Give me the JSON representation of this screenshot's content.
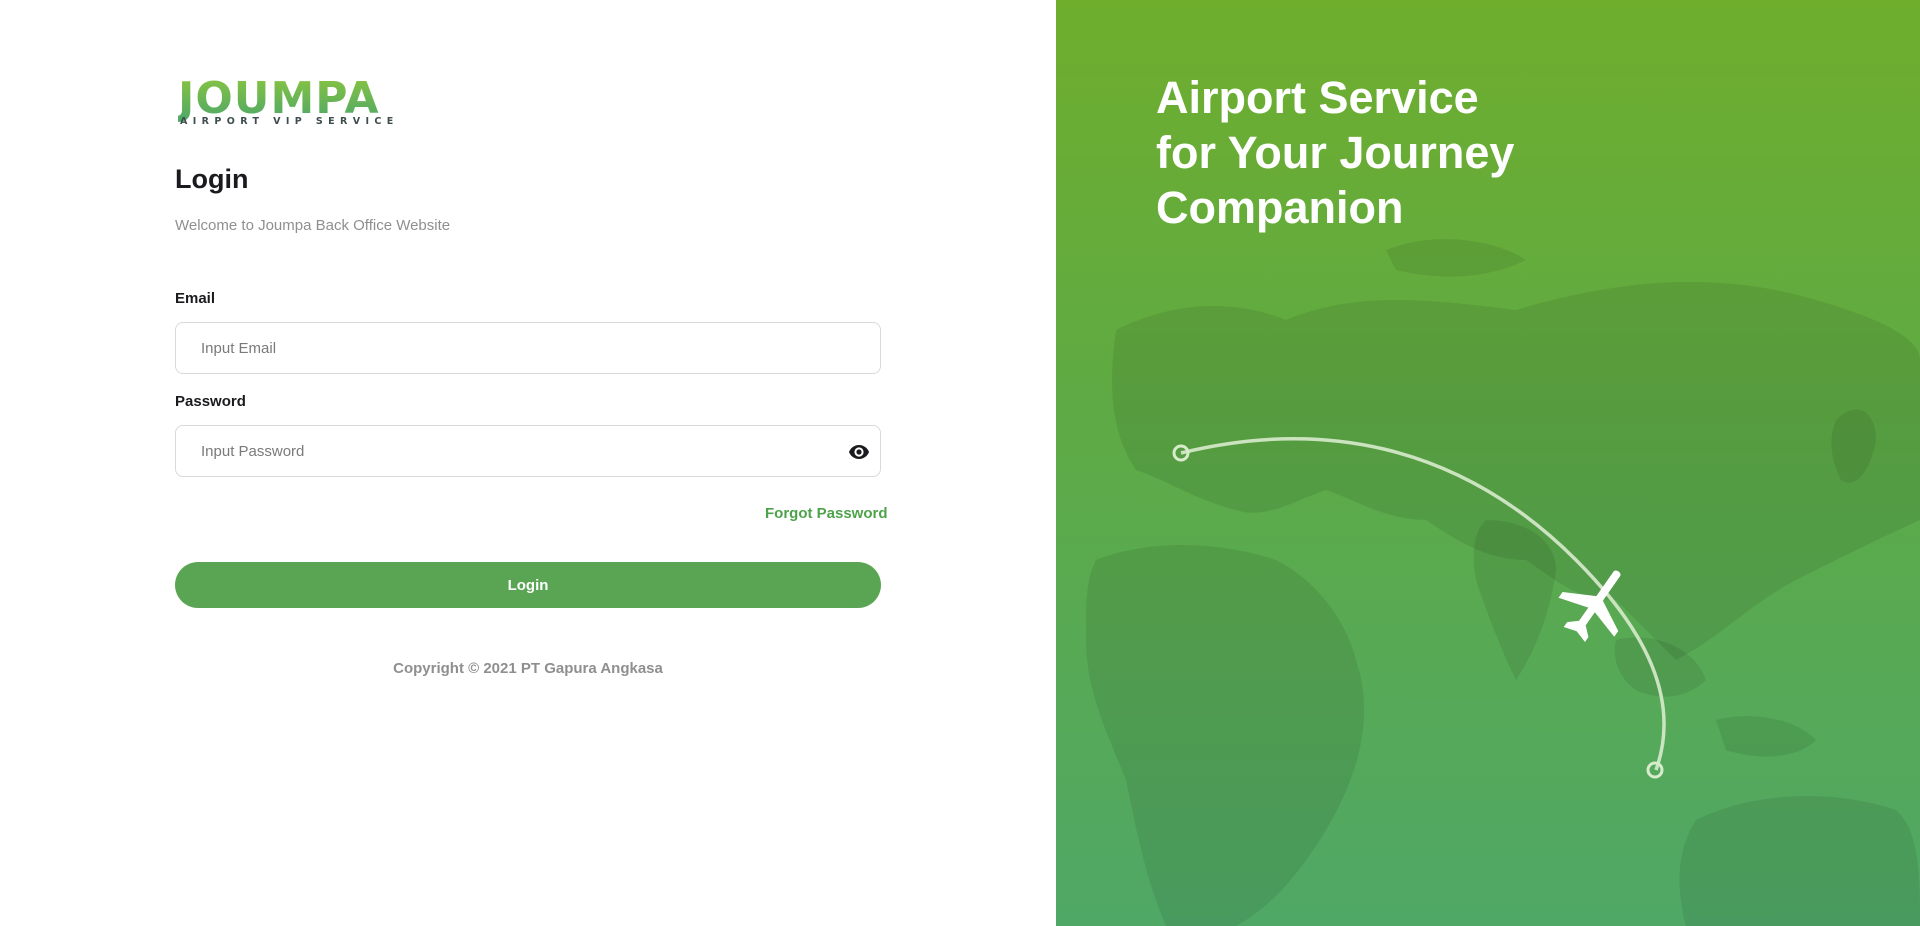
{
  "brand": {
    "logo_word": "JOUMPA",
    "logo_tagline": "AIRPORT VIP SERVICE",
    "colors": {
      "primary_green": "#5aa554",
      "link_green": "#4ea24a",
      "hero_top": "#6fae2d",
      "hero_bottom": "#4fa866"
    }
  },
  "login_form": {
    "title": "Login",
    "subtitle": "Welcome to Joumpa Back Office Website",
    "email_label": "Email",
    "email_placeholder": "Input Email",
    "password_label": "Password",
    "password_placeholder": "Input Password",
    "toggle_icon": "eye-icon",
    "forgot_password": "Forgot Password",
    "submit_label": "Login",
    "copyright": "Copyright © 2021 PT Gapura Angkasa"
  },
  "hero": {
    "lines": [
      "Airport Service",
      "for Your Journey",
      "Companion"
    ],
    "illustration_icons": [
      "world-map",
      "flight-route",
      "airplane-icon"
    ]
  }
}
